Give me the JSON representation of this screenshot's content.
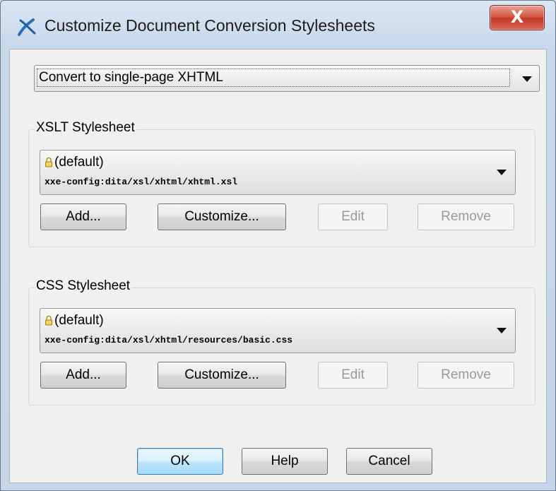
{
  "window": {
    "title": "Customize Document Conversion Stylesheets",
    "close_label": "X"
  },
  "conversion": {
    "selected": "Convert to single-page XHTML"
  },
  "xslt": {
    "title": "XSLT Stylesheet",
    "name": "(default)",
    "path": "xxe-config:dita/xsl/xhtml/xhtml.xsl",
    "buttons": {
      "add": "Add...",
      "customize": "Customize...",
      "edit": "Edit",
      "remove": "Remove"
    }
  },
  "css": {
    "title": "CSS Stylesheet",
    "name": "(default)",
    "path": "xxe-config:dita/xsl/xhtml/resources/basic.css",
    "buttons": {
      "add": "Add...",
      "customize": "Customize...",
      "edit": "Edit",
      "remove": "Remove"
    }
  },
  "footer": {
    "ok": "OK",
    "help": "Help",
    "cancel": "Cancel"
  },
  "icons": {
    "app": "xxe-icon",
    "lock": "lock-icon",
    "dropdown": "chevron-down-icon"
  }
}
